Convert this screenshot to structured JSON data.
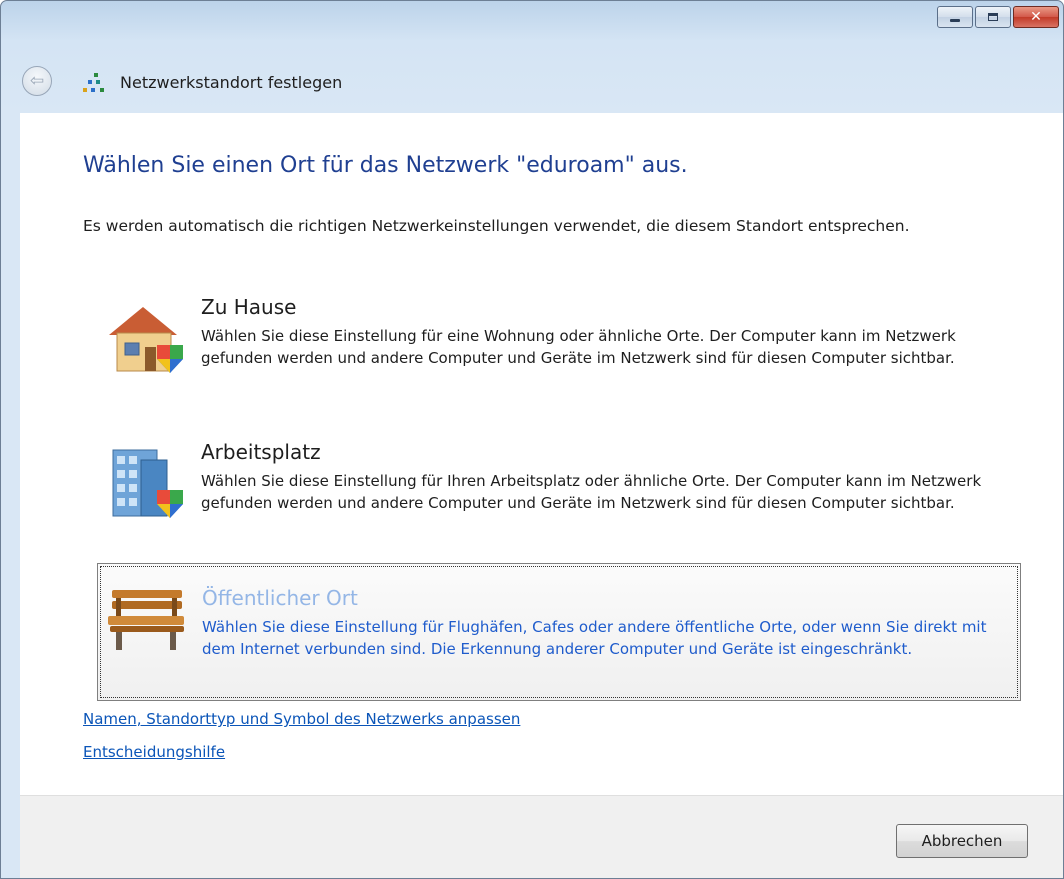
{
  "window": {
    "title": "Netzwerkstandort festlegen",
    "controls": {
      "minimize_icon": "minimize-icon",
      "maximize_icon": "maximize-icon",
      "close_icon": "close-icon",
      "close_glyph": "✕"
    }
  },
  "header": {
    "back_icon": "back-arrow-icon",
    "back_glyph": "⇦"
  },
  "main": {
    "title": "Wählen Sie einen Ort für das Netzwerk \"eduroam\" aus.",
    "description": "Es werden automatisch die richtigen Netzwerkeinstellungen verwendet, die diesem Standort entsprechen.",
    "options": [
      {
        "title": "Zu Hause",
        "text": "Wählen Sie diese Einstellung für eine Wohnung oder ähnliche Orte. Der Computer kann im Netzwerk gefunden werden und andere Computer und Geräte im Netzwerk sind für diesen Computer sichtbar.",
        "icon": "house-icon"
      },
      {
        "title": "Arbeitsplatz",
        "text": "Wählen Sie diese Einstellung für Ihren Arbeitsplatz oder ähnliche Orte. Der Computer kann im Netzwerk gefunden werden und andere Computer und Geräte im Netzwerk sind für diesen Computer sichtbar.",
        "icon": "office-building-icon"
      },
      {
        "title": "Öffentlicher Ort",
        "text": "Wählen Sie diese Einstellung für Flughäfen, Cafes oder andere öffentliche Orte, oder wenn Sie direkt mit dem Internet verbunden sind. Die Erkennung anderer Computer und Geräte ist eingeschränkt.",
        "icon": "park-bench-icon"
      }
    ],
    "links": {
      "customize": "Namen, Standorttyp und Symbol des Netzwerks anpassen",
      "help": "Entscheidungshilfe"
    }
  },
  "footer": {
    "cancel_label": "Abbrechen"
  },
  "colors": {
    "title_blue": "#1f3f91",
    "link_blue": "#0b55b8",
    "selected_text": "#1f5ccc",
    "selected_title": "#94b6e6"
  }
}
